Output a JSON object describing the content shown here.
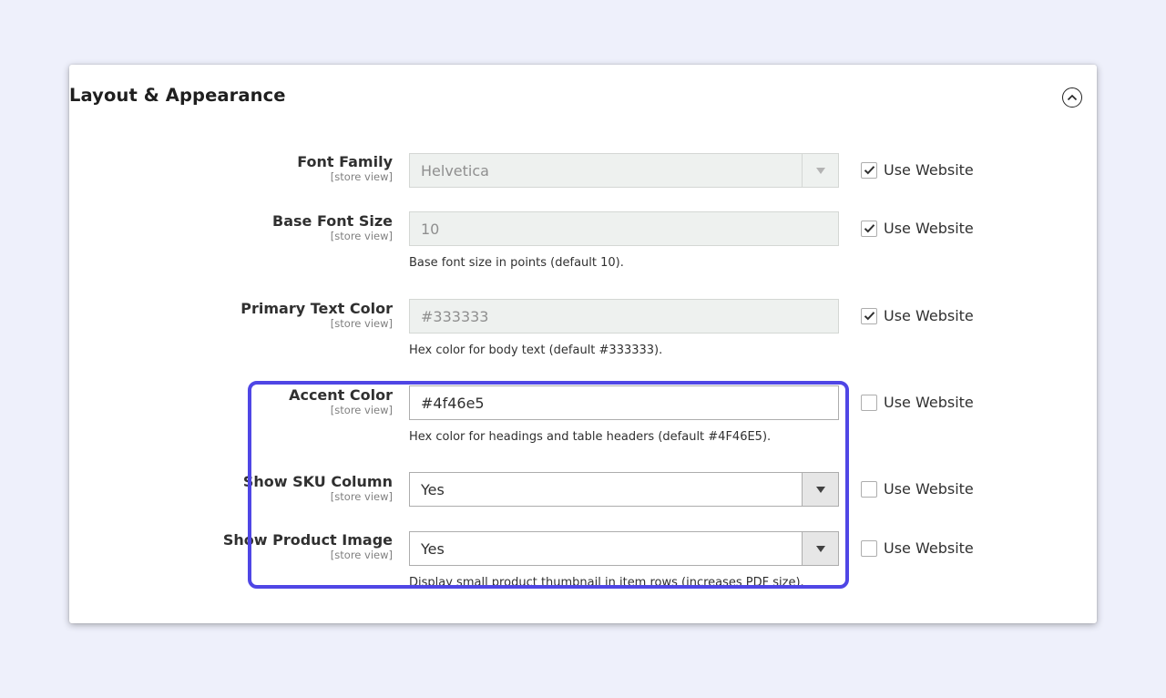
{
  "section": {
    "title": "Layout & Appearance",
    "collapse_icon": "chevron-up-circle-icon"
  },
  "fields": {
    "font_family": {
      "label": "Font Family",
      "scope": "[store view]",
      "value": "Helvetica",
      "use_website": "Use Website",
      "use_website_checked": true
    },
    "base_font_size": {
      "label": "Base Font Size",
      "scope": "[store view]",
      "value": "10",
      "note": "Base font size in points (default 10).",
      "use_website": "Use Website",
      "use_website_checked": true
    },
    "primary_text_color": {
      "label": "Primary Text Color",
      "scope": "[store view]",
      "value": "#333333",
      "note": "Hex color for body text (default #333333).",
      "use_website": "Use Website",
      "use_website_checked": true
    },
    "accent_color": {
      "label": "Accent Color",
      "scope": "[store view]",
      "value": "#4f46e5",
      "note": "Hex color for headings and table headers (default #4F46E5).",
      "use_website": "Use Website",
      "use_website_checked": false
    },
    "show_sku_column": {
      "label": "Show SKU Column",
      "scope": "[store view]",
      "value": "Yes",
      "use_website": "Use Website",
      "use_website_checked": false
    },
    "show_product_image": {
      "label": "Show Product Image",
      "scope": "[store view]",
      "value": "Yes",
      "note": "Display small product thumbnail in item rows (increases PDF size).",
      "use_website": "Use Website",
      "use_website_checked": false
    }
  },
  "colors": {
    "page_background": "#eef0fb",
    "highlight": "#4f46e5",
    "disabled_field": "#eef1ef"
  }
}
